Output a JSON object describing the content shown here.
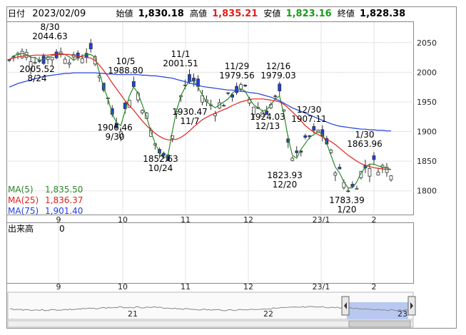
{
  "header": {
    "date_label": "日付",
    "date_value": "2023/02/09",
    "open_label": "始値",
    "open_value": "1,830.18",
    "high_label": "高値",
    "high_value": "1,835.21",
    "low_label": "安値",
    "low_value": "1,823.16",
    "close_label": "終値",
    "close_value": "1,828.38"
  },
  "legend": {
    "ma5_label": "MA(5)",
    "ma5_value": "1,835.50",
    "ma25_label": "MA(25)",
    "ma25_value": "1,836.37",
    "ma75_label": "MA(75)",
    "ma75_value": "1,901.40",
    "volume_label": "出来高",
    "volume_value": "0"
  },
  "colors": {
    "ma5": "#2a8a2a",
    "ma25": "#e0201c",
    "ma75": "#1f3fe0",
    "candle": "#1f3fe0",
    "grid": "#c8c8c8",
    "navigator_selection": "#b8c8f0"
  },
  "navigator": {
    "labels": [
      "21",
      "22",
      "23"
    ],
    "left_handle_icon": "triangle-left-icon",
    "right_handle_icon": "triangle-right-icon"
  },
  "chart_data": {
    "type": "candlestick",
    "title": "",
    "y_ticks": [
      "2050",
      "2000",
      "1950",
      "1900",
      "1850",
      "1800"
    ],
    "ylim": [
      1760,
      2075
    ],
    "x_ticks": [
      "9",
      "10",
      "11",
      "12",
      "23/1",
      "2"
    ],
    "volume_x_ticks": [
      "9",
      "10",
      "11",
      "12",
      "23/1",
      "2"
    ],
    "grid": true,
    "annotations": [
      {
        "date": "8/30",
        "value": "2044.63"
      },
      {
        "date": "8/24",
        "value": "2005.52"
      },
      {
        "date": "9/30",
        "value": "1906.46"
      },
      {
        "date": "10/5",
        "value": "1988.80"
      },
      {
        "date": "10/24",
        "value": "1852.63"
      },
      {
        "date": "11/1",
        "value": "2001.51"
      },
      {
        "date": "11/7",
        "value": "1930.47"
      },
      {
        "date": "11/29",
        "value": "1979.56"
      },
      {
        "date": "12/16",
        "value": "1979.03"
      },
      {
        "date": "12/13",
        "value": "1924.03"
      },
      {
        "date": "12/30",
        "value": "1907.11"
      },
      {
        "date": "12/20",
        "value": "1823.93"
      },
      {
        "date": "1/30",
        "value": "1863.96"
      },
      {
        "date": "1/20",
        "value": "1783.39"
      }
    ],
    "series": [
      {
        "name": "MA(5)",
        "values": [
          2020,
          2028,
          2030,
          2032,
          2030,
          2025,
          2025,
          2020,
          2022,
          2025,
          2028,
          2030,
          2032,
          2030,
          2026,
          2020,
          2025,
          2028,
          2030,
          2030,
          2025,
          2000,
          1975,
          1955,
          1930,
          1915,
          1910,
          1935,
          1960,
          1975,
          1965,
          1945,
          1925,
          1900,
          1880,
          1865,
          1855,
          1860,
          1900,
          1935,
          1960,
          1975,
          1985,
          1985,
          1975,
          1962,
          1950,
          1945,
          1940,
          1945,
          1950,
          1955,
          1965,
          1970,
          1972,
          1968,
          1955,
          1945,
          1940,
          1935,
          1937,
          1945,
          1955,
          1960,
          1930,
          1890,
          1860,
          1855,
          1870,
          1880,
          1890,
          1895,
          1900,
          1895,
          1880,
          1860,
          1840,
          1830,
          1815,
          1805,
          1805,
          1815,
          1830,
          1840,
          1845,
          1845,
          1842,
          1840,
          1838,
          1836
        ]
      },
      {
        "name": "MA(25)",
        "values": [
          2022,
          2024,
          2026,
          2027,
          2028,
          2028,
          2029,
          2029,
          2029,
          2029,
          2030,
          2030,
          2030,
          2030,
          2030,
          2028,
          2027,
          2026,
          2025,
          2024,
          2020,
          2012,
          2003,
          1993,
          1982,
          1972,
          1962,
          1952,
          1944,
          1936,
          1927,
          1918,
          1910,
          1903,
          1897,
          1892,
          1888,
          1886,
          1886,
          1887,
          1890,
          1895,
          1901,
          1908,
          1914,
          1920,
          1924,
          1928,
          1931,
          1934,
          1937,
          1940,
          1944,
          1947,
          1950,
          1952,
          1954,
          1955,
          1955,
          1955,
          1954,
          1953,
          1952,
          1950,
          1946,
          1940,
          1933,
          1926,
          1918,
          1910,
          1904,
          1899,
          1895,
          1891,
          1887,
          1883,
          1878,
          1872,
          1866,
          1860,
          1855,
          1850,
          1846,
          1843,
          1841,
          1839,
          1838,
          1837,
          1836,
          1836
        ]
      },
      {
        "name": "MA(75)",
        "values": [
          1975,
          1978,
          1981,
          1983,
          1985,
          1987,
          1989,
          1991,
          1993,
          1994,
          1995,
          1996,
          1997,
          1998,
          1998,
          1999,
          1999,
          1999,
          1999,
          1999,
          1999,
          1998,
          1998,
          1997,
          1997,
          1996,
          1996,
          1996,
          1996,
          1996,
          1996,
          1995,
          1995,
          1994,
          1994,
          1993,
          1992,
          1991,
          1990,
          1988,
          1986,
          1984,
          1982,
          1980,
          1978,
          1976,
          1975,
          1974,
          1973,
          1972,
          1971,
          1970,
          1970,
          1969,
          1968,
          1967,
          1966,
          1965,
          1964,
          1962,
          1960,
          1958,
          1955,
          1952,
          1948,
          1944,
          1940,
          1937,
          1934,
          1931,
          1928,
          1925,
          1922,
          1919,
          1916,
          1913,
          1911,
          1909,
          1908,
          1907,
          1906,
          1905,
          1904,
          1904,
          1903,
          1903,
          1902,
          1902,
          1901,
          1901
        ]
      }
    ]
  }
}
